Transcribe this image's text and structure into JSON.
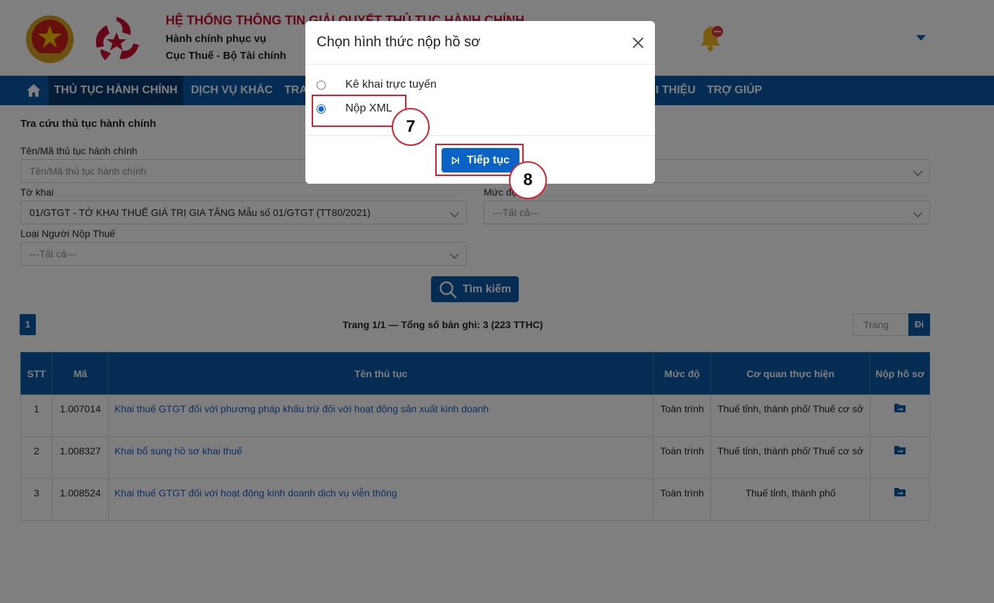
{
  "header": {
    "title": "HỆ THỐNG THÔNG TIN GIẢI QUYẾT THỦ TỤC HÀNH CHÍNH",
    "subtitle1": "Hành chính phục vụ",
    "subtitle2": "Cục Thuế - Bộ Tài chính"
  },
  "nav": {
    "items": [
      {
        "label": "THỦ TỤC HÀNH CHÍNH"
      },
      {
        "label": "DỊCH VỤ KHÁC"
      },
      {
        "label": "TRA"
      },
      {
        "label": "I THIỆU"
      },
      {
        "label": "TRỢ GIÚP"
      }
    ]
  },
  "search": {
    "panel_title": "Tra cứu thủ tục hành chính",
    "name_label": "Tên/Mã thủ tục hành chính",
    "name_placeholder": "Tên/Mã thủ tục hành chính",
    "form_label": "Tờ khai",
    "form_value": "01/GTGT - TỜ KHAI THUẾ GIÁ TRỊ GIA TĂNG Mẫu số 01/GTGT (TT80/2021)",
    "level_label": "Mức độ",
    "level_value": "---Tất cả---",
    "taxpayer_label": "Loại Người Nộp Thuế",
    "taxpayer_value": "---Tất cả---",
    "button_label": "Tìm kiếm"
  },
  "pagination": {
    "current_page": "1",
    "info": "Trang 1/1 — Tổng số bản ghi: 3 (223 TTHC)",
    "page_placeholder": "Trang",
    "go_label": "Đi"
  },
  "table": {
    "headers": [
      "STT",
      "Mã",
      "Tên thủ tục",
      "Mức độ",
      "Cơ quan thực hiện",
      "Nộp hồ sơ"
    ],
    "rows": [
      {
        "stt": "1",
        "code": "1.007014",
        "name": "Khai thuế GTGT đối với phương pháp khấu trừ đối với hoạt động sản xuất kinh doanh",
        "level": "Toàn trình",
        "agency": "Thuế tỉnh, thành phố/ Thuế cơ sở"
      },
      {
        "stt": "2",
        "code": "1.008327",
        "name": "Khai bổ sung hồ sơ khai thuế",
        "level": "Toàn trình",
        "agency": "Thuế tỉnh, thành phố/ Thuế cơ sở"
      },
      {
        "stt": "3",
        "code": "1.008524",
        "name": "Khai thuế GTGT đối với hoạt động kinh doanh dịch vụ viễn thông",
        "level": "Toàn trình",
        "agency": "Thuế tỉnh, thành phố"
      }
    ]
  },
  "modal": {
    "title": "Chọn hình thức nộp hồ sơ",
    "option_online": "Kê khai trực tuyến",
    "option_xml": "Nộp XML",
    "selected": "Nộp XML",
    "continue_label": "Tiếp tục"
  },
  "annotations": {
    "step7": "7",
    "step8": "8"
  },
  "colors": {
    "primary": "#0b5ba8",
    "nav_active": "#063a73",
    "title_red": "#c8102e",
    "annotation_red": "#d81e2a",
    "link": "#1a5fc2"
  }
}
